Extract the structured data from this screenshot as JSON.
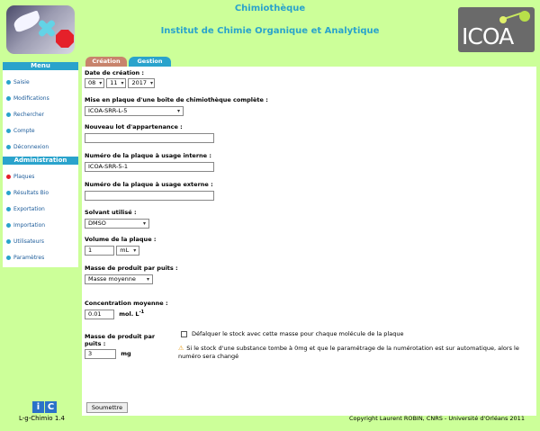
{
  "header": {
    "app_title": "Chimiothèque",
    "institute": "Institut de Chimie Organique et Analytique",
    "right_logo_text": "ICOA"
  },
  "sidebar": {
    "menu_title": "Menu",
    "menu_items": [
      "Saisie",
      "Modifications",
      "Rechercher",
      "Compte",
      "Déconnexion"
    ],
    "admin_title": "Administration",
    "admin_items": [
      "Plaques",
      "Résultats Bio",
      "Exportation",
      "Importation",
      "Utilisateurs",
      "Paramètres"
    ],
    "footer_logo": [
      "i",
      "C"
    ],
    "footer_version": "L-g-Chimio 1.4"
  },
  "tabs": [
    "Création",
    "Gestion"
  ],
  "form": {
    "date_label": "Date de création :",
    "day": "08",
    "month": "11",
    "year": "2017",
    "plate_label": "Mise en plaque d'une boite de chimiothèque complète :",
    "plate_value": "ICOA-SRR-L-5",
    "lot_label": "Nouveau lot d'appartenance :",
    "lot_value": "",
    "internal_label": "Numéro de la plaque à usage interne :",
    "internal_value": "ICOA-SRR-5-1",
    "external_label": "Numéro de la plaque à usage externe :",
    "external_value": "",
    "solvent_label": "Solvant utilisé :",
    "solvent_value": "DMSO",
    "volume_label": "Volume de la plaque :",
    "volume_value": "1",
    "volume_unit": "mL",
    "mass_label": "Masse de produit par puits :",
    "mass_value": "Masse moyenne",
    "conc_label": "Concentration moyenne :",
    "conc_value": "0.01",
    "conc_unit": "mol. L",
    "conc_exp": "-1",
    "mass_pp_label": "Masse de produit par puits :",
    "mass_pp_value": "3",
    "mass_pp_unit": "mg",
    "checkbox_label": "Défalquer le stock avec cette masse pour chaque molécule de la plaque",
    "warning": "Si le stock d'une substance tombe à 0mg et que le paramétrage de la numérotation est sur automatique, alors le numéro sera changé",
    "submit": "Soumettre"
  },
  "copyright": "Copyright Laurent ROBIN, CNRS - Université d'Orléans 2011"
}
